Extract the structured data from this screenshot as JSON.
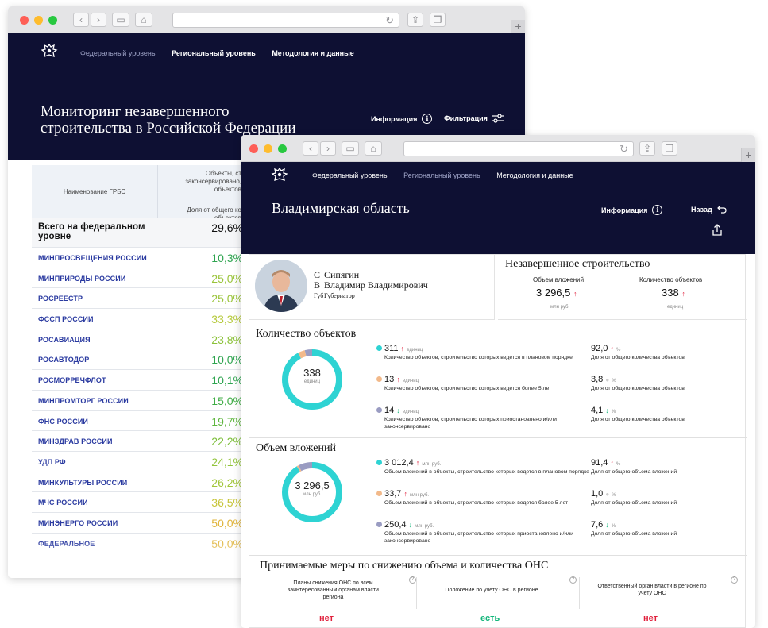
{
  "back": {
    "nav": [
      "Федеральный уровень",
      "Региональный уровень",
      "Методология и данные"
    ],
    "title_line1": "Мониторинг незавершенного",
    "title_line2": "строительства в Российской Федерации",
    "info_label": "Информация",
    "filter_label": "Фильтрация",
    "table": {
      "col_name": "Наименование ГРБС",
      "col_objects": "Объекты, ст",
      "col_objects2": "законсервировано,",
      "col_objects3": "объектов",
      "col_share": "Доля от общего ко",
      "col_share2": "объектов",
      "total_name": "Всего на федеральном уровне",
      "total_value": "29,6%",
      "rows": [
        {
          "name": "МИНПРОСВЕЩЕНИЯ РОССИИ",
          "value": "10,3%",
          "color": "#2ea44f"
        },
        {
          "name": "МИНПРИРОДЫ РОССИИ",
          "value": "25,0%",
          "color": "#9ac43a"
        },
        {
          "name": "РОСРЕЕСТР",
          "value": "25,0%",
          "color": "#9ac43a"
        },
        {
          "name": "ФССП РОССИИ",
          "value": "33,3%",
          "color": "#b5c93a"
        },
        {
          "name": "РОСАВИАЦИЯ",
          "value": "23,8%",
          "color": "#8cc23a"
        },
        {
          "name": "РОСАВТОДОР",
          "value": "10,0%",
          "color": "#2ea44f"
        },
        {
          "name": "РОСМОРРЕЧФЛОТ",
          "value": "10,1%",
          "color": "#2ea44f"
        },
        {
          "name": "МИНПРОМТОРГ РОССИИ",
          "value": "15,0%",
          "color": "#3fac45"
        },
        {
          "name": "ФНС РОССИИ",
          "value": "19,7%",
          "color": "#5fb63f"
        },
        {
          "name": "МИНЗДРАВ РОССИИ",
          "value": "22,2%",
          "color": "#7fbf3d"
        },
        {
          "name": "УДП РФ",
          "value": "24,1%",
          "color": "#92c43b"
        },
        {
          "name": "МИНКУЛЬТУРЫ РОССИИ",
          "value": "26,2%",
          "color": "#a2c63a"
        },
        {
          "name": "МЧС РОССИИ",
          "value": "36,5%",
          "color": "#c7c538"
        },
        {
          "name": "МИНЭНЕРГО РОССИИ",
          "value": "50,0%",
          "color": "#e0b43a"
        },
        {
          "name": "ФЕДЕРАЛЬНОЕ",
          "value": "50,0%",
          "color": "#e0b43a"
        }
      ]
    }
  },
  "front": {
    "nav": [
      "Федеральный уровень",
      "Региональный уровень",
      "Методология и данные"
    ],
    "region": "Владимирская область",
    "info_label": "Информация",
    "back_label": "Назад",
    "person": {
      "overlay_surname": "С",
      "overlay_name": "В",
      "overlay_pos": "Губ",
      "surname": "Сипягин",
      "name": "Владимир Владимирович",
      "position": "Губернатор"
    },
    "unfinished": {
      "title": "Незавершенное строительство",
      "invest_label": "Объем вложений",
      "invest_value": "3 296,5",
      "invest_unit": "млн руб.",
      "count_label": "Количество объектов",
      "count_value": "338",
      "count_unit": "единиц"
    },
    "objects": {
      "title": "Количество объектов",
      "donut_value": "338",
      "donut_unit": "единиц",
      "items": [
        {
          "value": "311",
          "unit": "единиц",
          "desc": "Количество объектов, строительство которых ведется в плановом порядке",
          "pct": "92,0",
          "pct_label": "Доля от общего количества объектов",
          "color": "#2ed3d3",
          "dir": "up",
          "pct_dir": "up"
        },
        {
          "value": "13",
          "unit": "единиц",
          "desc": "Количество объектов, строительство которых ведется более 5 лет",
          "pct": "3,8",
          "pct_label": "Доля от общего количества объектов",
          "color": "#f2b98a",
          "dir": "up",
          "pct_dir": "none"
        },
        {
          "value": "14",
          "unit": "единиц",
          "desc": "Количество объектов, строительство которых приостановлено и/или законсервировано",
          "pct": "4,1",
          "pct_label": "Доля от общего количества объектов",
          "color": "#9a9cc2",
          "dir": "down",
          "pct_dir": "down"
        }
      ],
      "pct_sign": "%"
    },
    "invest": {
      "title": "Объем вложений",
      "donut_value": "3 296,5",
      "donut_unit": "млн руб.",
      "items": [
        {
          "value": "3 012,4",
          "unit": "млн руб.",
          "desc": "Объем вложений в объекты, строительство которых ведется в плановом порядке",
          "pct": "91,4",
          "pct_label": "Доля от общего объема вложений",
          "color": "#2ed3d3",
          "dir": "up",
          "pct_dir": "up"
        },
        {
          "value": "33,7",
          "unit": "млн руб.",
          "desc": "Объем вложений в объекты, строительство которых ведется более 5 лет",
          "pct": "1,0",
          "pct_label": "Доля от общего объема вложений",
          "color": "#f2b98a",
          "dir": "up",
          "pct_dir": "none"
        },
        {
          "value": "250,4",
          "unit": "млн руб.",
          "desc": "Объем вложений в объекты, строительство которых приостановлено и/или законсервировано",
          "pct": "7,6",
          "pct_label": "Доля от общего объема вложений",
          "color": "#9a9cc2",
          "dir": "down",
          "pct_dir": "down"
        }
      ],
      "pct_sign": "%"
    },
    "measures": {
      "title": "Принимаемые меры по снижению объема и количества ОНС",
      "col1": "Планы снижения ОНС по всем заинтересованным органам власти региона",
      "col2": "Положение по учету ОНС в регионе",
      "col3": "Ответственный орган власти в регионе по учету ОНС",
      "val1": "нет",
      "val2": "есть",
      "val3": "нет"
    }
  },
  "colors": {
    "navy": "#0e1033",
    "teal": "#2ed3d3",
    "peach": "#f2b98a",
    "lavender": "#9a9cc2",
    "red": "#e0203c",
    "green": "#13b67a"
  }
}
